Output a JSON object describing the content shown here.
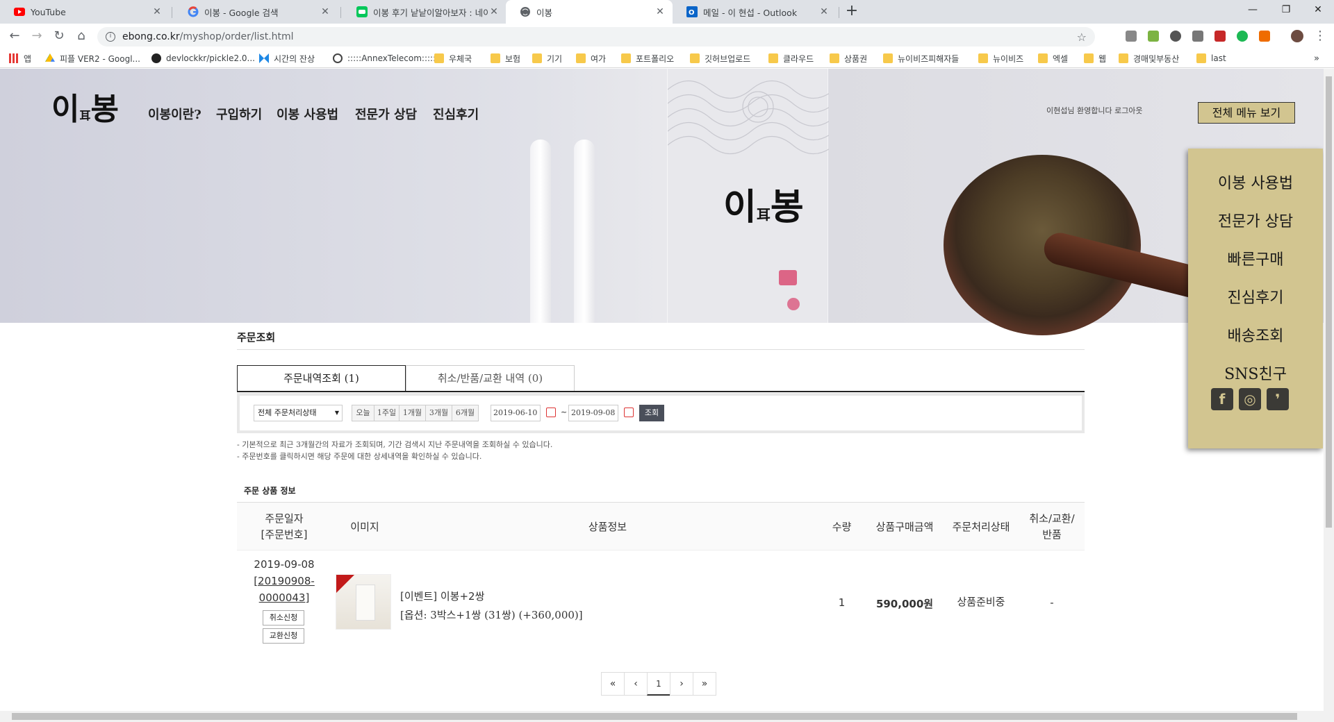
{
  "browser": {
    "tabs": [
      {
        "title": "YouTube",
        "icon": "youtube-icon"
      },
      {
        "title": "이봉 - Google 검색",
        "icon": "google-icon"
      },
      {
        "title": "이봉 후기 낱낱이알아보자 : 네이",
        "icon": "naver-blog-icon"
      },
      {
        "title": "이봉",
        "icon": "globe-icon"
      },
      {
        "title": "메일 - 이 현섭 - Outlook",
        "icon": "outlook-icon"
      }
    ],
    "url_host": "ebong.co.kr",
    "url_path": "/myshop/order/list.html",
    "bookmarks": [
      {
        "label": "앱",
        "icon": "apps-grid-icon"
      },
      {
        "label": "피플 VER2 - Googl...",
        "icon": "google-drive-icon"
      },
      {
        "label": "devlockkr/pickle2.0...",
        "icon": "github-icon"
      },
      {
        "label": "시간의 잔상",
        "icon": "site-icon"
      },
      {
        "label": ":::::AnnexTelecom:::::",
        "icon": "globe-icon"
      },
      {
        "label": "우체국",
        "icon": "folder-icon"
      },
      {
        "label": "보험",
        "icon": "folder-icon"
      },
      {
        "label": "기기",
        "icon": "folder-icon"
      },
      {
        "label": "여가",
        "icon": "folder-icon"
      },
      {
        "label": "포트폴리오",
        "icon": "folder-icon"
      },
      {
        "label": "깃허브업로드",
        "icon": "folder-icon"
      },
      {
        "label": "클라우드",
        "icon": "folder-icon"
      },
      {
        "label": "상품권",
        "icon": "folder-icon"
      },
      {
        "label": "뉴이비즈피해자들",
        "icon": "folder-icon"
      },
      {
        "label": "뉴이비즈",
        "icon": "folder-icon"
      },
      {
        "label": "엑셀",
        "icon": "folder-icon"
      },
      {
        "label": "웹",
        "icon": "folder-icon"
      },
      {
        "label": "경매및부동산",
        "icon": "folder-icon"
      },
      {
        "label": "last",
        "icon": "folder-icon"
      }
    ],
    "overflow_label": "»"
  },
  "site": {
    "logo": {
      "main": "이",
      "sub": "耳",
      "end": "봉"
    },
    "nav": [
      "이봉이란?",
      "구입하기",
      "이봉 사용법",
      "전문가 상담",
      "진심후기"
    ],
    "welcome": "이현섭님 환영합니다 로그아웃",
    "menu_all": "전체 메뉴 보기",
    "quick_menu": [
      "이봉 사용법",
      "전문가 상담",
      "빠른구매",
      "진심후기",
      "배송조회",
      "SNS친구"
    ],
    "sns": [
      {
        "name": "facebook-icon",
        "glyph": "f"
      },
      {
        "name": "instagram-icon",
        "glyph": "◎"
      },
      {
        "name": "blog-icon",
        "glyph": "❜"
      }
    ]
  },
  "order": {
    "title": "주문조회",
    "tabs": [
      "주문내역조회 (1)",
      "취소/반품/교환 내역 (0)"
    ],
    "filter": {
      "status": "전체 주문처리상태",
      "periods": [
        "오늘",
        "1주일",
        "1개월",
        "3개월",
        "6개월"
      ],
      "date_from": "2019-06-10",
      "tilde": "~",
      "date_to": "2019-09-08",
      "search": "조회"
    },
    "notes": [
      "- 기본적으로 최근 3개월간의 자료가 조회되며, 기간 검색시 지난 주문내역을 조회하실 수 있습니다.",
      "- 주문번호를 클릭하시면 해당 주문에 대한 상세내역을 확인하실 수 있습니다."
    ],
    "section_label": "주문 상품 정보",
    "columns": {
      "date_line1": "주문일자",
      "date_line2": "[주문번호]",
      "image": "이미지",
      "info": "상품정보",
      "qty": "수량",
      "amount": "상품구매금액",
      "status": "주문처리상태",
      "cancel_line1": "취소/교환/",
      "cancel_line2": "반품"
    },
    "row": {
      "date": "2019-09-08",
      "order_no_1": "[20190908-",
      "order_no_2": "0000043]",
      "cancel_btn": "취소신청",
      "exchange_btn": "교환신청",
      "product": "[이벤트] 이봉+2쌍",
      "option": "[옵션: 3박스+1쌍 (31쌍) (+360,000)]",
      "qty": "1",
      "amount": "590,000원",
      "status": "상품준비중",
      "cancel": "-"
    },
    "pager": {
      "first": "«",
      "prev": "‹",
      "current": "1",
      "next": "›",
      "last": "»"
    }
  },
  "colors": {
    "accent_gold": "#d2c590",
    "dark": "#222222",
    "search_btn": "#4a4f5a"
  }
}
